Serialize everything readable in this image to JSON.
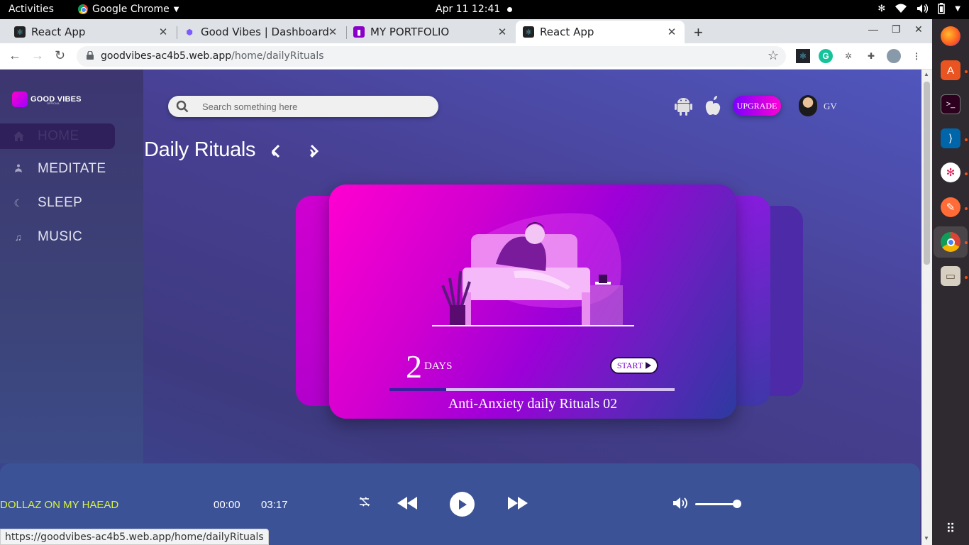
{
  "system_bar": {
    "activities": "Activities",
    "app_name": "Google Chrome",
    "clock": "Apr 11  12:41"
  },
  "browser": {
    "tabs": [
      {
        "label": "React App"
      },
      {
        "label": "Good Vibes | Dashboard"
      },
      {
        "label": "MY PORTFOLIO"
      },
      {
        "label": "React App"
      }
    ],
    "url_host": "goodvibes-ac4b5.web.app",
    "url_path": "/home/dailyRituals",
    "status_url": "https://goodvibes-ac4b5.web.app/home/dailyRituals"
  },
  "brand": {
    "name": "GOOD VIBES",
    "tagline": "OFFICIAL"
  },
  "sidebar": {
    "items": [
      {
        "label": "HOME",
        "icon": "home-icon",
        "active": true
      },
      {
        "label": "MEDITATE",
        "icon": "meditate-icon"
      },
      {
        "label": "SLEEP",
        "icon": "moon-icon"
      },
      {
        "label": "MUSIC",
        "icon": "music-note-icon"
      }
    ]
  },
  "header": {
    "search_placeholder": "Search something here",
    "upgrade_label": "UPGRADE",
    "user_name": "GV"
  },
  "main": {
    "title": "Daily Rituals",
    "card": {
      "days_number": "2",
      "days_label": "DAYS",
      "start_label": "START",
      "title": "Anti-Anxiety daily Rituals 02",
      "progress": 0.2
    }
  },
  "player": {
    "song_title": "DOLLAZ ON MY HAEAD",
    "current_time": "00:00",
    "duration": "03:17",
    "volume": 1.0
  },
  "colors": {
    "accent_magenta": "#ff00d0",
    "accent_purple": "#7a00ff",
    "song_title": "#d8f23c",
    "player_bg": "#3b5296"
  }
}
